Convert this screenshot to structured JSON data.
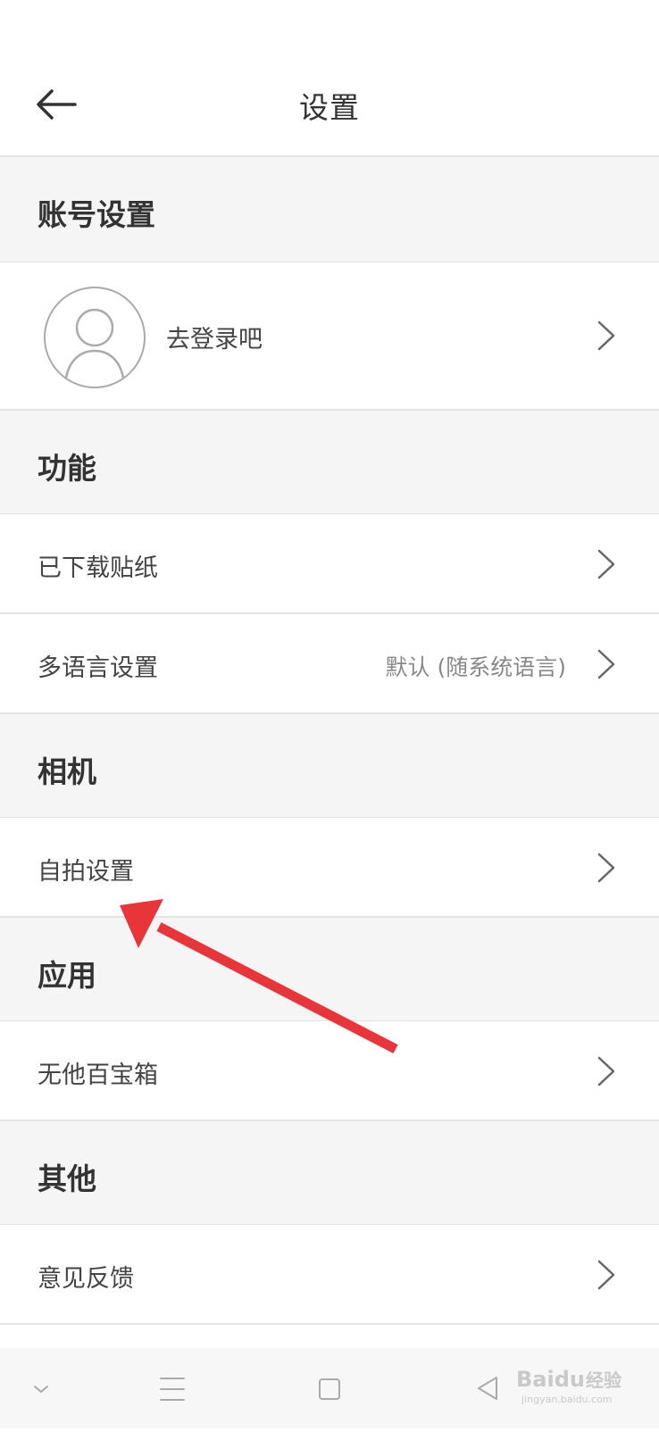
{
  "header": {
    "title": "设置",
    "back_icon": "arrow-left-icon"
  },
  "sections": {
    "account": "账号设置",
    "features": "功能",
    "camera": "相机",
    "apps": "应用",
    "others": "其他"
  },
  "account": {
    "login_label": "去登录吧"
  },
  "features": {
    "downloaded_stickers": "已下载贴纸",
    "language": {
      "label": "多语言设置",
      "value": "默认 (随系统语言)"
    }
  },
  "camera": {
    "selfie_settings": "自拍设置"
  },
  "apps": {
    "toolbox": "无他百宝箱"
  },
  "others": {
    "feedback": "意见反馈"
  },
  "watermark": {
    "brand": "Baidu",
    "brand_cn": "经验",
    "url": "jingyan.baidu.com"
  },
  "colors": {
    "annotation_arrow": "#e8353a",
    "section_bg": "#f5f5f5",
    "divider": "#e3e3e3"
  }
}
